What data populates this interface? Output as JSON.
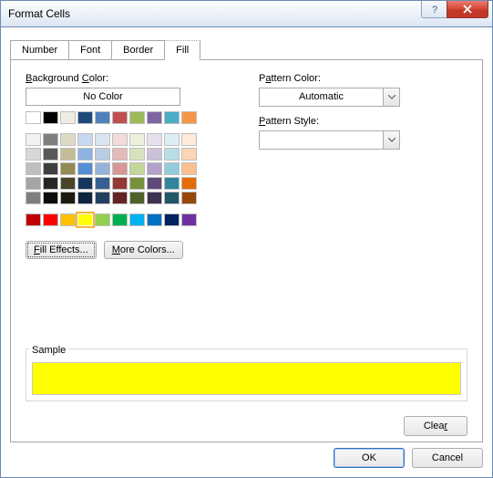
{
  "title": "Format Cells",
  "tabs": [
    "Number",
    "Font",
    "Border",
    "Fill"
  ],
  "active_tab": 3,
  "labels": {
    "bgcolor": "Background Color:",
    "nocolor": "No Color",
    "fill_effects": "Fill Effects...",
    "more_colors": "More Colors...",
    "pattern_color": "Pattern Color:",
    "pattern_style": "Pattern Style:",
    "automatic": "Automatic",
    "sample": "Sample",
    "clear": "Clear",
    "ok": "OK",
    "cancel": "Cancel"
  },
  "theme_colors_row1": [
    "#ffffff",
    "#000000",
    "#eeece1",
    "#1f497d",
    "#4f81bd",
    "#c0504d",
    "#9bbb59",
    "#8064a2",
    "#4bacc6",
    "#f79646"
  ],
  "theme_shades": [
    [
      "#f2f2f2",
      "#7f7f7f",
      "#ddd9c3",
      "#c6d9f0",
      "#dbe5f1",
      "#f2dcdb",
      "#ebf1dd",
      "#e5e0ec",
      "#dbeef3",
      "#fdeada"
    ],
    [
      "#d8d8d8",
      "#595959",
      "#c4bd97",
      "#8db3e2",
      "#b8cce4",
      "#e5b9b7",
      "#d7e3bc",
      "#ccc1d9",
      "#b7dde8",
      "#fbd5b5"
    ],
    [
      "#bfbfbf",
      "#3f3f3f",
      "#938953",
      "#548dd4",
      "#95b3d7",
      "#d99694",
      "#c3d69b",
      "#b2a2c7",
      "#92cddc",
      "#fac08f"
    ],
    [
      "#a5a5a5",
      "#262626",
      "#494429",
      "#17365d",
      "#366092",
      "#953734",
      "#76923c",
      "#5f497a",
      "#31859b",
      "#e36c09"
    ],
    [
      "#7f7f7f",
      "#0c0c0c",
      "#1d1b10",
      "#0f243e",
      "#244061",
      "#632423",
      "#4f6128",
      "#3f3151",
      "#205867",
      "#974806"
    ]
  ],
  "standard_colors": [
    "#c00000",
    "#ff0000",
    "#ffc000",
    "#ffff00",
    "#92d050",
    "#00b050",
    "#00b0f0",
    "#0070c0",
    "#002060",
    "#7030a0"
  ],
  "selected_standard_index": 3,
  "sample_color": "#ffff00"
}
